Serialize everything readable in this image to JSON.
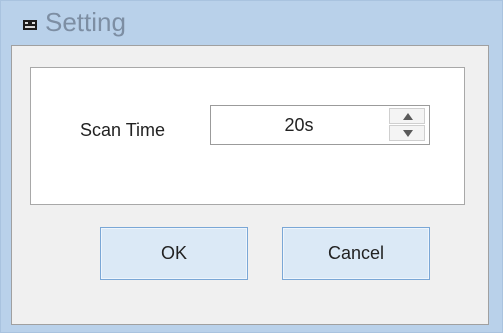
{
  "window": {
    "title": "Setting",
    "app_icon": "window-app-icon"
  },
  "form": {
    "scan_time_label": "Scan Time",
    "scan_time_value": "20s",
    "spin_up_icon": "chevron-up-icon",
    "spin_down_icon": "chevron-down-icon"
  },
  "buttons": {
    "ok_label": "OK",
    "cancel_label": "Cancel"
  },
  "colors": {
    "frame": "#b9d1ea",
    "title_text": "#7d8ea3",
    "client_bg": "#f0f0f0",
    "button_bg": "#dbe9f6",
    "button_border": "#7aa7d6"
  }
}
